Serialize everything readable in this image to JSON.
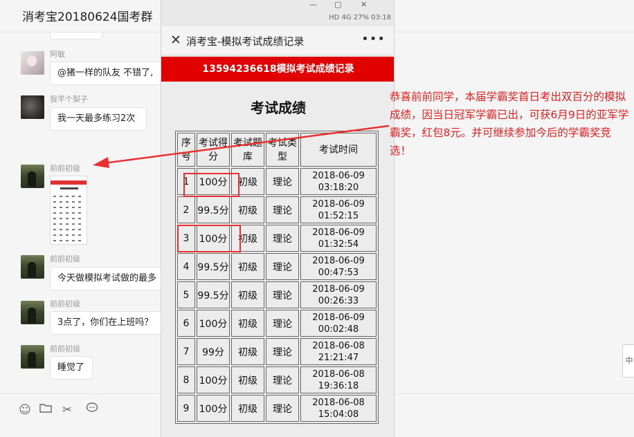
{
  "chat": {
    "title": "消考宝20180624国考群",
    "messages": [
      {
        "sender": "阿敏",
        "text": "@猪一样的队友 不错了,"
      },
      {
        "sender": "我芊个梨子",
        "text": "我一天最多练习2次"
      },
      {
        "sender": "前前初级",
        "text": ""
      },
      {
        "sender": "前前初级",
        "text": "今天做模拟考试做的最多"
      },
      {
        "sender": "前前初级",
        "text": "3点了，你们在上班吗？"
      },
      {
        "sender": "前前初级",
        "text": "睡觉了"
      }
    ],
    "toolbar_icons": [
      "emoji-icon",
      "folder-icon",
      "scissors-icon",
      "chat-bubble-icon"
    ]
  },
  "phone": {
    "status_text": "HD 4G  27%  03:18",
    "nav_title": "消考宝-模拟考试成绩记录",
    "banner": "13594236618模拟考试成绩记录",
    "heading": "考试成绩",
    "table": {
      "headers": [
        "序号",
        "考试得分",
        "考试题库",
        "考试类型",
        "考试时间"
      ],
      "rows": [
        {
          "no": "1",
          "score": "100分",
          "bank": "初级",
          "type": "理论",
          "date": "2018-06-09",
          "time": "03:18:20"
        },
        {
          "no": "2",
          "score": "99.5分",
          "bank": "初级",
          "type": "理论",
          "date": "2018-06-09",
          "time": "01:52:15"
        },
        {
          "no": "3",
          "score": "100分",
          "bank": "初级",
          "type": "理论",
          "date": "2018-06-09",
          "time": "01:32:54"
        },
        {
          "no": "4",
          "score": "99.5分",
          "bank": "初级",
          "type": "理论",
          "date": "2018-06-09",
          "time": "00:47:53"
        },
        {
          "no": "5",
          "score": "99.5分",
          "bank": "初级",
          "type": "理论",
          "date": "2018-06-09",
          "time": "00:26:33"
        },
        {
          "no": "6",
          "score": "100分",
          "bank": "初级",
          "type": "理论",
          "date": "2018-06-09",
          "time": "00:02:48"
        },
        {
          "no": "7",
          "score": "99分",
          "bank": "初级",
          "type": "理论",
          "date": "2018-06-08",
          "time": "21:21:47"
        },
        {
          "no": "8",
          "score": "100分",
          "bank": "初级",
          "type": "理论",
          "date": "2018-06-08",
          "time": "19:36:18"
        },
        {
          "no": "9",
          "score": "100分",
          "bank": "初级",
          "type": "理论",
          "date": "2018-06-08",
          "time": "15:04:08"
        }
      ]
    }
  },
  "annotation": {
    "text": "恭喜前前同学，本届学霸奖首日考出双百分的模拟成绩，因当日冠军学霸已出，可获6月9日的亚军学霸奖，红包8元。并可继续参加今后的学霸奖竞选！",
    "color": "#e02020"
  },
  "colors": {
    "banner_red": "#e10000",
    "highlight_red": "#e83030"
  }
}
